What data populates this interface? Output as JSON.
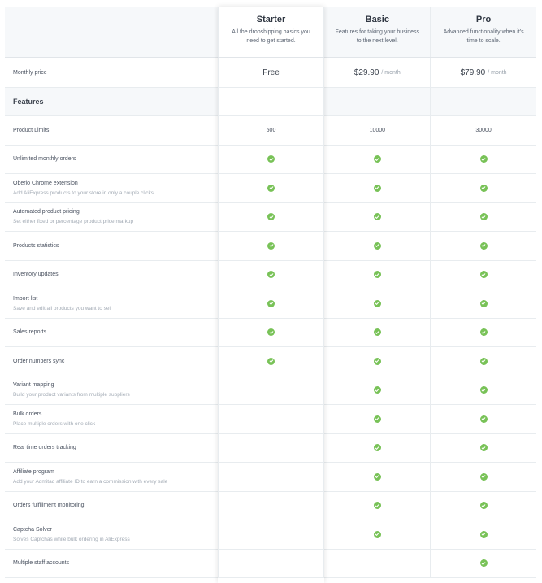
{
  "plans": [
    {
      "name": "Starter",
      "desc": "All the dropshipping basics you need to get started."
    },
    {
      "name": "Basic",
      "desc": "Features for taking your business to the next level."
    },
    {
      "name": "Pro",
      "desc": "Advanced functionality when it's time to scale."
    }
  ],
  "price": {
    "label": "Monthly price",
    "starter": "Free",
    "basic": "$29.90",
    "pro": "$79.90",
    "unit": "/ month"
  },
  "section_title": "Features",
  "limits": {
    "label": "Product Limits",
    "starter": "500",
    "basic": "10000",
    "pro": "30000"
  },
  "features": [
    {
      "label": "Unlimited monthly orders",
      "sub": "",
      "checks": [
        true,
        true,
        true
      ]
    },
    {
      "label": "Oberlo Chrome extension",
      "sub": "Add AliExpress products to your store in only a couple clicks",
      "checks": [
        true,
        true,
        true
      ]
    },
    {
      "label": "Automated product pricing",
      "sub": "Set either fixed or percentage product price markup",
      "checks": [
        true,
        true,
        true
      ]
    },
    {
      "label": "Products statistics",
      "sub": "",
      "checks": [
        true,
        true,
        true
      ]
    },
    {
      "label": "Inventory updates",
      "sub": "",
      "checks": [
        true,
        true,
        true
      ]
    },
    {
      "label": "Import list",
      "sub": "Save and edit all products you want to sell",
      "checks": [
        true,
        true,
        true
      ]
    },
    {
      "label": "Sales reports",
      "sub": "",
      "checks": [
        true,
        true,
        true
      ]
    },
    {
      "label": "Order numbers sync",
      "sub": "",
      "checks": [
        true,
        true,
        true
      ]
    },
    {
      "label": "Variant mapping",
      "sub": "Build your product variants from multiple suppliers",
      "checks": [
        false,
        true,
        true
      ]
    },
    {
      "label": "Bulk orders",
      "sub": "Place multiple orders with one click",
      "checks": [
        false,
        true,
        true
      ]
    },
    {
      "label": "Real time orders tracking",
      "sub": "",
      "checks": [
        false,
        true,
        true
      ]
    },
    {
      "label": "Affiliate program",
      "sub": "Add your Admitad affiliate ID to earn a commission with every sale",
      "checks": [
        false,
        true,
        true
      ]
    },
    {
      "label": "Orders fulfillment monitoring",
      "sub": "",
      "checks": [
        false,
        true,
        true
      ]
    },
    {
      "label": "Captcha Solver",
      "sub": "Solves Captchas while bulk ordering in AliExpress",
      "checks": [
        false,
        true,
        true
      ]
    },
    {
      "label": "Multiple staff accounts",
      "sub": "",
      "checks": [
        false,
        false,
        true
      ]
    }
  ],
  "colors": {
    "check": "#78c257",
    "header_bg": "#f6f8fa"
  },
  "icons": {
    "check": "check-circle-icon"
  }
}
